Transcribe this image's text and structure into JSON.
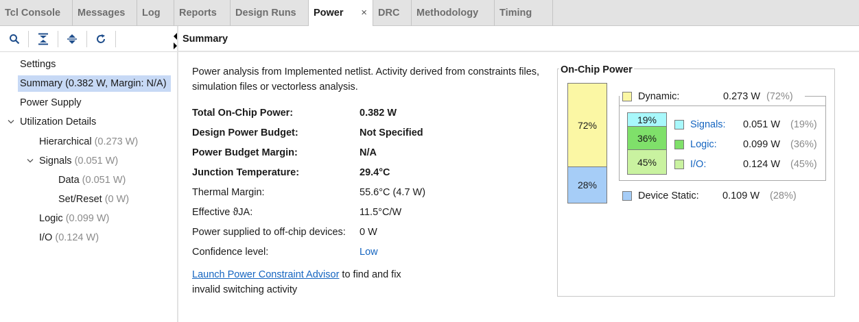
{
  "tabs": [
    {
      "label": "Tcl Console"
    },
    {
      "label": "Messages"
    },
    {
      "label": "Log"
    },
    {
      "label": "Reports"
    },
    {
      "label": "Design Runs"
    },
    {
      "label": "Power",
      "close": "×"
    },
    {
      "label": "DRC"
    },
    {
      "label": "Methodology"
    },
    {
      "label": "Timing"
    }
  ],
  "toolbar": {
    "search_icon": "search-icon",
    "collapse_icon": "collapse-all-icon",
    "expand_icon": "expand-all-icon",
    "refresh_icon": "refresh-icon"
  },
  "tree": {
    "settings": "Settings",
    "summary": "Summary (0.382 W, Margin: N/A)",
    "power_supply": "Power Supply",
    "utilization": "Utilization Details",
    "hierarchical": {
      "label": "Hierarchical",
      "value": "(0.273 W)"
    },
    "signals": {
      "label": "Signals",
      "value": "(0.051 W)"
    },
    "data": {
      "label": "Data",
      "value": "(0.051 W)"
    },
    "setreset": {
      "label": "Set/Reset",
      "value": "(0 W)"
    },
    "logic": {
      "label": "Logic",
      "value": "(0.099 W)"
    },
    "io": {
      "label": "I/O",
      "value": "(0.124 W)"
    }
  },
  "summary": {
    "header": "Summary",
    "intro": "Power analysis from Implemented netlist. Activity derived from constraints files, simulation files or vectorless analysis.",
    "rows": [
      {
        "label": "Total On-Chip Power:",
        "value": "0.382 W"
      },
      {
        "label": "Design Power Budget:",
        "value": "Not Specified"
      },
      {
        "label": "Power Budget Margin:",
        "value": "N/A"
      },
      {
        "label": "Junction Temperature:",
        "value": "29.4°C"
      },
      {
        "label": "Thermal Margin:",
        "value": "55.6°C (4.7 W)"
      },
      {
        "label": "Effective ϑJA:",
        "value": "11.5°C/W"
      },
      {
        "label": "Power supplied to off-chip devices:",
        "value": "0 W"
      },
      {
        "label": "Confidence level:",
        "value": "Low"
      }
    ],
    "launch_link": "Launch Power Constraint Advisor",
    "launch_text": " to find and fix invalid switching activity"
  },
  "on_chip": {
    "title": "On-Chip Power",
    "bar": {
      "dynamic_pct": "72%",
      "static_pct": "28%",
      "dynamic_fraction": 0.72,
      "static_fraction": 0.28
    },
    "dynamic": {
      "label": "Dynamic:",
      "value": "0.273 W",
      "pct": "(72%)",
      "color": "#fbf7a4"
    },
    "device_static": {
      "label": "Device Static:",
      "value": "0.109 W",
      "pct": "(28%)",
      "color": "#a6cdf7"
    },
    "sub": [
      {
        "label": "Signals:",
        "value": "0.051 W",
        "pct": "(19%)",
        "bar": "19%",
        "color": "#a8f8fb"
      },
      {
        "label": "Logic:",
        "value": "0.099 W",
        "pct": "(36%)",
        "bar": "36%",
        "color": "#7fe06a"
      },
      {
        "label": "I/O:",
        "value": "0.124 W",
        "pct": "(45%)",
        "bar": "45%",
        "color": "#c9f2a0"
      }
    ]
  }
}
